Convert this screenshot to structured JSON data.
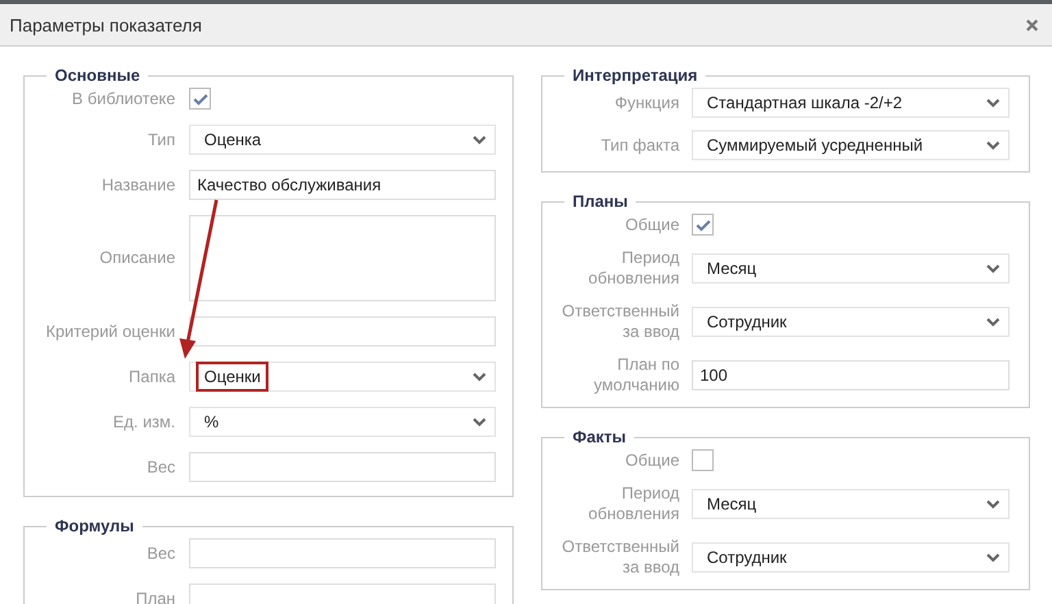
{
  "dialog": {
    "title": "Параметры показателя"
  },
  "left_column": [
    {
      "legend": "Основные",
      "fields": [
        {
          "kind": "checkbox",
          "label": "В библиотеке",
          "checked": true
        },
        {
          "kind": "select",
          "label": "Тип",
          "value": "Оценка"
        },
        {
          "kind": "text",
          "label": "Название",
          "value": "Качество обслуживания"
        },
        {
          "kind": "textarea",
          "label": "Описание"
        },
        {
          "kind": "text",
          "label": "Критерий оценки"
        },
        {
          "kind": "select",
          "label": "Папка",
          "value": "Оценки",
          "highlighted": true
        },
        {
          "kind": "select",
          "label": "Ед. изм.",
          "value": "%"
        },
        {
          "kind": "text",
          "label": "Вес"
        }
      ]
    },
    {
      "legend": "Формулы",
      "fields": [
        {
          "kind": "text",
          "label": "Вес"
        },
        {
          "kind": "text",
          "label": "План"
        }
      ]
    }
  ],
  "right_column": [
    {
      "legend": "Интерпретация",
      "fields": [
        {
          "kind": "select",
          "label": "Функция",
          "value": "Стандартная шкала -2/+2"
        },
        {
          "kind": "select",
          "label": "Тип факта",
          "value": "Суммируемый усредненный"
        }
      ]
    },
    {
      "legend": "Планы",
      "fields": [
        {
          "kind": "checkbox",
          "label": "Общие",
          "checked": true
        },
        {
          "kind": "select",
          "label": "Период обновления",
          "value": "Месяц"
        },
        {
          "kind": "select",
          "label": "Ответственный за ввод",
          "value": "Сотрудник"
        },
        {
          "kind": "text",
          "label": "План по умолчанию",
          "value": "100"
        }
      ]
    },
    {
      "legend": "Факты",
      "fields": [
        {
          "kind": "checkbox",
          "label": "Общие",
          "checked": false
        },
        {
          "kind": "select",
          "label": "Период обновления",
          "value": "Месяц"
        },
        {
          "kind": "select",
          "label": "Ответственный за ввод",
          "value": "Сотрудник"
        }
      ]
    }
  ]
}
